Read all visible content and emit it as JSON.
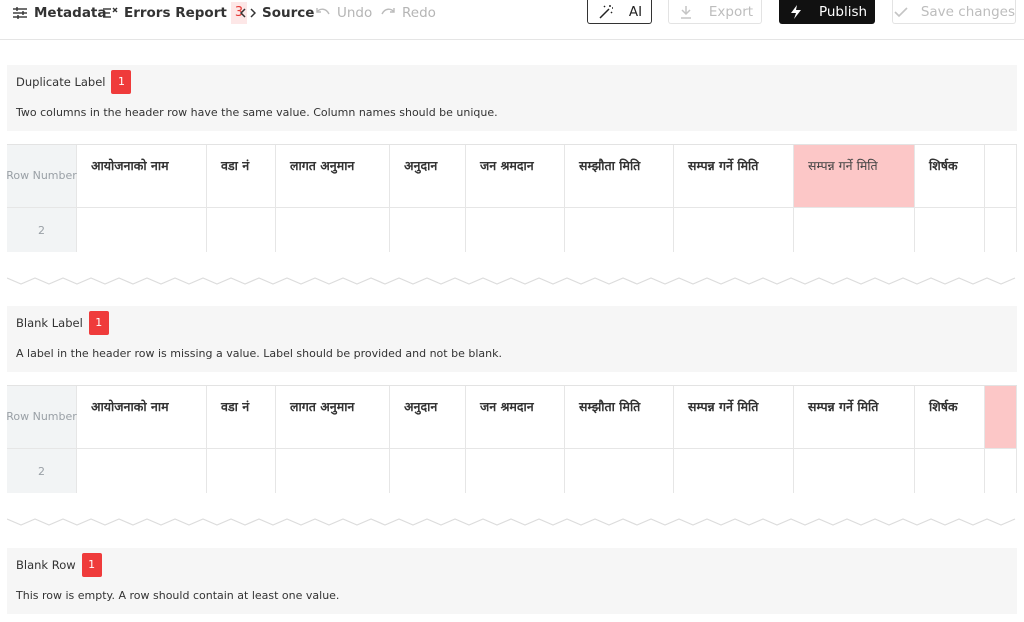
{
  "toolbar": {
    "metadata_label": "Metadata",
    "errors_label": "Errors Report",
    "errors_count": "3",
    "source_label": "Source",
    "undo_label": "Undo",
    "redo_label": "Redo",
    "ai_label": "AI",
    "export_label": "Export",
    "publish_label": "Publish",
    "save_label": "Save changes"
  },
  "columns": [
    "आयोजनाको नाम",
    "वडा नं",
    "लागत अनुमान",
    "अनुदान",
    "जन श्रमदान",
    "सम्झौता मिति",
    "सम्पन्न गर्ने मिति",
    "सम्पन्न गर्ने मिति",
    "शिर्षक",
    ""
  ],
  "row_number_label": "Row Number",
  "row_number_value": "2",
  "errors": [
    {
      "title": "Duplicate Label",
      "count": "1",
      "description": "Two columns in the header row have the same value. Column names should be unique."
    },
    {
      "title": "Blank Label",
      "count": "1",
      "description": "A label in the header row is missing a value. Label should be provided and not be blank."
    },
    {
      "title": "Blank Row",
      "count": "1",
      "description": "This row is empty. A row should contain at least one value."
    }
  ],
  "colors": {
    "error_badge": "#ef3b3b",
    "highlight_cell": "#fcc7c7",
    "publish_bg": "#111111"
  }
}
